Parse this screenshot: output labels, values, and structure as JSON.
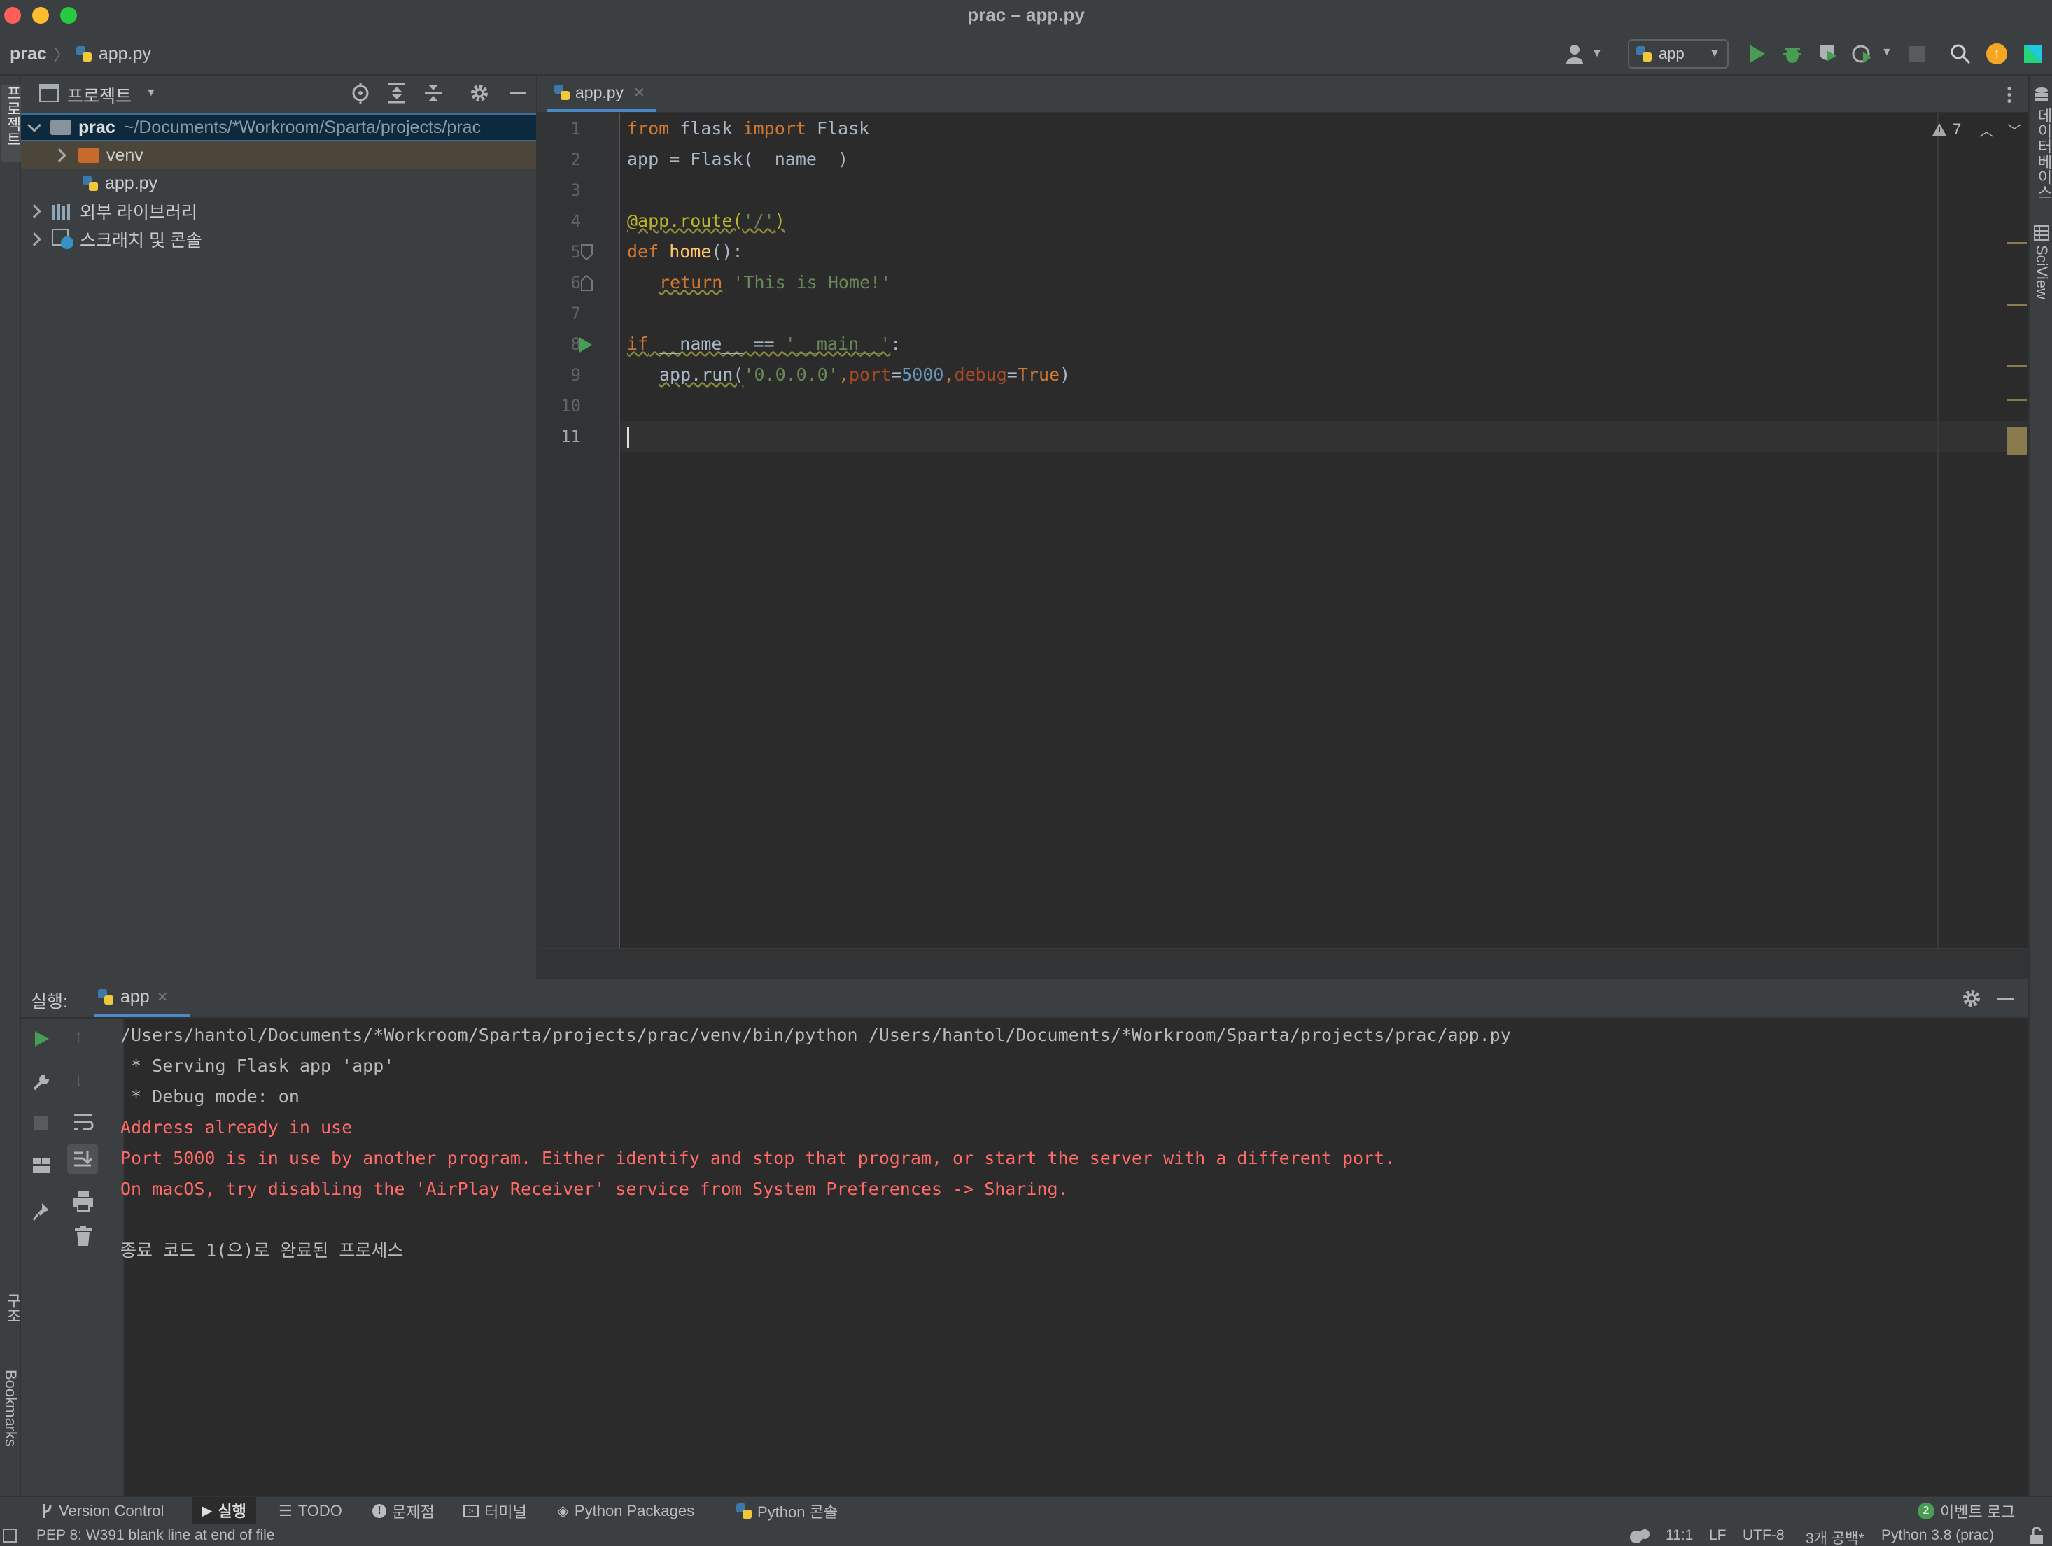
{
  "window": {
    "title": "prac – app.py"
  },
  "breadcrumb": {
    "project": "prac",
    "file": "app.py"
  },
  "toolbar": {
    "run_config": "app"
  },
  "project_panel": {
    "title": "프로젝트",
    "root": {
      "name": "prac",
      "path": "~/Documents/*Workroom/Sparta/projects/prac"
    },
    "items": [
      {
        "label": "venv"
      },
      {
        "label": "app.py"
      },
      {
        "label": "외부 라이브러리"
      },
      {
        "label": "스크래치 및 콘솔"
      }
    ]
  },
  "left_stripe": {
    "project_tab": "프로젝트",
    "structure_tab": "구조",
    "bookmarks_tab": "Bookmarks"
  },
  "right_stripe": {
    "database_tab": "데이터베이스",
    "sciview_tab": "SciView"
  },
  "editor": {
    "tab": "app.py",
    "warnings": "7",
    "line_numbers": [
      "1",
      "2",
      "3",
      "4",
      "5",
      "6",
      "7",
      "8",
      "9",
      "10",
      "11"
    ],
    "code": {
      "l1": {
        "from": "from",
        "mod": " flask ",
        "import": "import",
        "name": " Flask"
      },
      "l2": {
        "text": "app = Flask(__name__)"
      },
      "l4": {
        "text": "@app.route(",
        "arg": "'/'",
        "close": ")"
      },
      "l5": {
        "def": "def",
        "name": " home",
        "rest": "():"
      },
      "l6": {
        "ret": "return",
        "str": " 'This is Home!'"
      },
      "l8": {
        "if": "if",
        "a": " __name__ == ",
        "str": "'__main__'",
        "end": ":"
      },
      "l9": {
        "a": "app.run(",
        "host": "'0.0.0.0'",
        "comma1": ",",
        "port_k": "port",
        "eq1": "=",
        "port_v": "5000",
        "comma2": ",",
        "debug_k": "debug",
        "eq2": "=",
        "debug_v": "True",
        "close": ")"
      }
    }
  },
  "run_panel": {
    "label": "실행:",
    "tab": "app",
    "output": {
      "cmd": "/Users/hantol/Documents/*Workroom/Sparta/projects/prac/venv/bin/python /Users/hantol/Documents/*Workroom/Sparta/projects/prac/app.py",
      "l1": " * Serving Flask app 'app'",
      "l2": " * Debug mode: on",
      "e1": "Address already in use",
      "e2": "Port 5000 is in use by another program. Either identify and stop that program, or start the server with a different port.",
      "e3": "On macOS, try disabling the 'AirPlay Receiver' service from System Preferences -> Sharing.",
      "exit": "종료 코드 1(으)로 완료된 프로세스"
    }
  },
  "tool_windows": [
    {
      "label": "Version Control"
    },
    {
      "label": "실행"
    },
    {
      "label": "TODO"
    },
    {
      "label": "문제점"
    },
    {
      "label": "터미널"
    },
    {
      "label": "Python Packages"
    },
    {
      "label": "Python 콘솔"
    }
  ],
  "event_log": {
    "count": "2",
    "label": "이벤트 로그"
  },
  "status": {
    "message": "PEP 8: W391 blank line at end of file",
    "position": "11:1",
    "line_sep": "LF",
    "encoding": "UTF-8",
    "indent": "3개 공백*",
    "interpreter": "Python 3.8 (prac)"
  },
  "colors": {
    "keyword": "#cc7832",
    "string": "#6a8759",
    "number": "#6897bb",
    "function": "#ffc66d",
    "error": "#ff6b68",
    "run_green": "#499c54"
  }
}
